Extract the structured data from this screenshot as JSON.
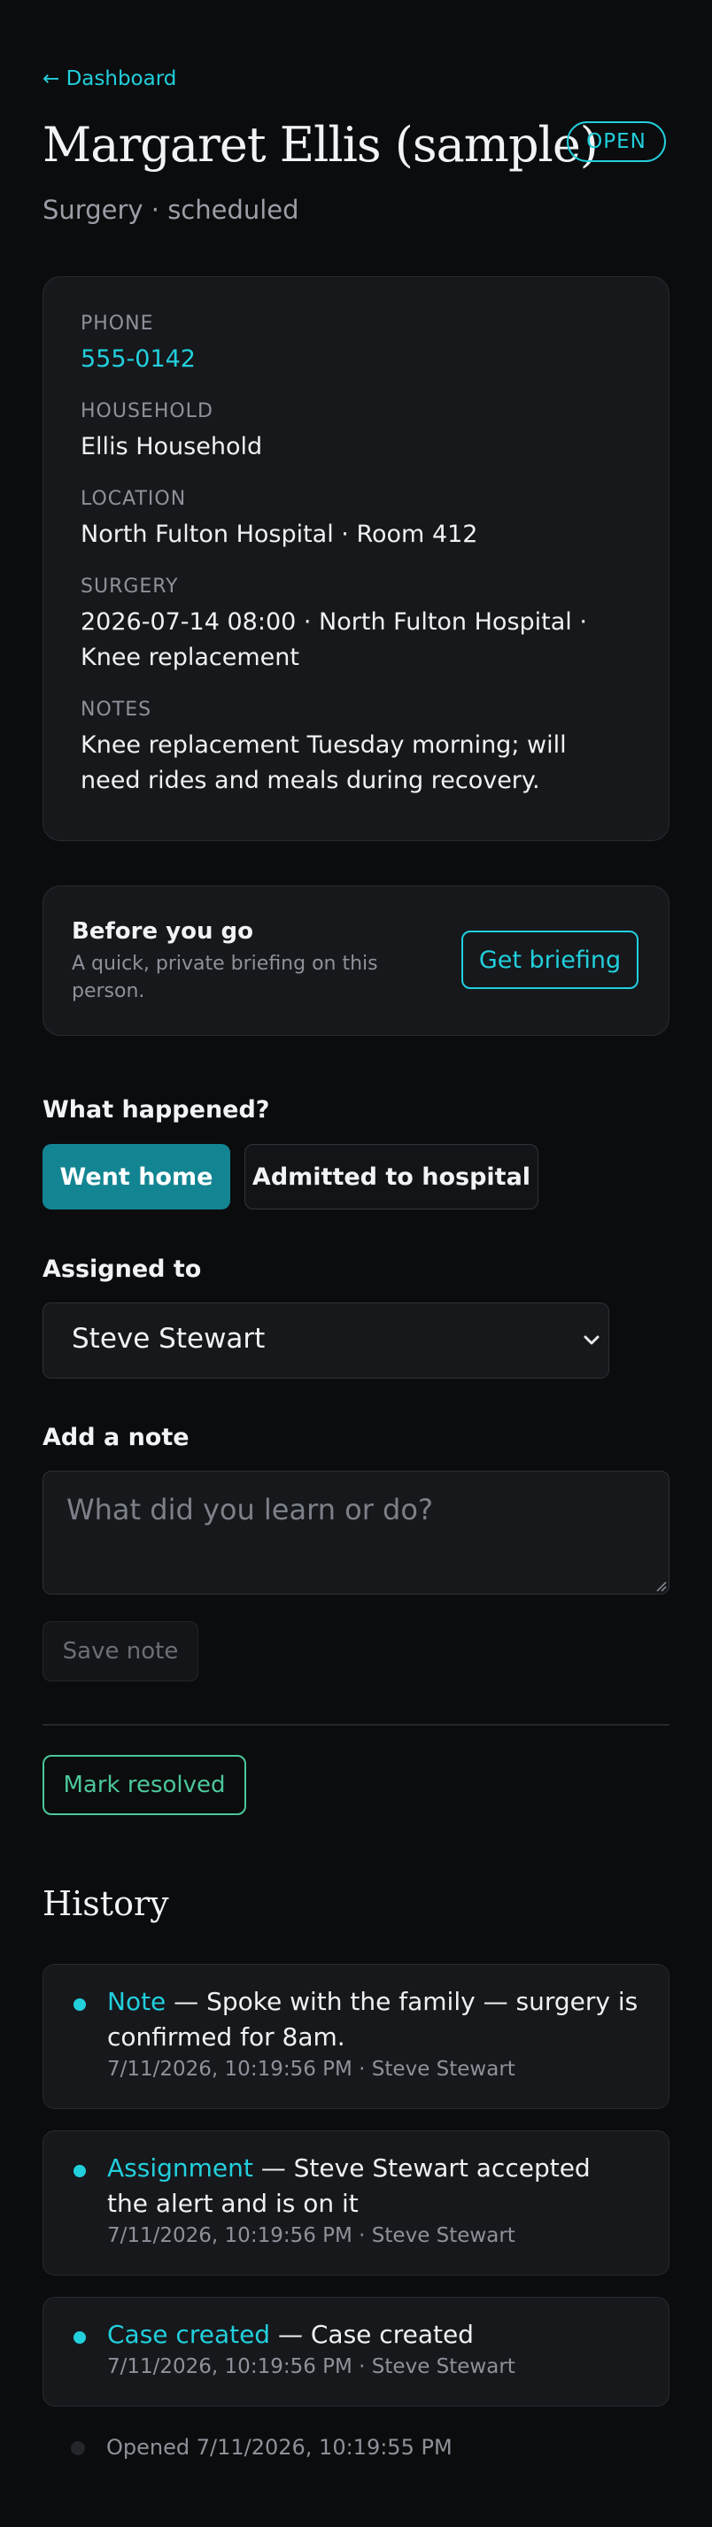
{
  "nav": {
    "back_label": "← Dashboard"
  },
  "header": {
    "title": "Margaret Ellis (sample)",
    "status": "OPEN",
    "subtitle": "Surgery · scheduled"
  },
  "details": [
    {
      "label": "PHONE",
      "value": "555-0142"
    },
    {
      "label": "HOUSEHOLD",
      "value": "Ellis Household"
    },
    {
      "label": "LOCATION",
      "value": "North Fulton Hospital · Room 412"
    },
    {
      "label": "SURGERY",
      "value": "2026-07-14 08:00 · North Fulton Hospital · Knee replacement"
    },
    {
      "label": "NOTES",
      "value": "Knee replacement Tuesday morning; will need rides and meals during recovery."
    }
  ],
  "briefing": {
    "title": "Before you go",
    "subtitle": "A quick, private briefing on this person.",
    "button": "Get briefing"
  },
  "outcome": {
    "label": "What happened?",
    "options": [
      "Went home",
      "Admitted to hospital"
    ],
    "selected": "Went home"
  },
  "assigned": {
    "label": "Assigned to",
    "value": "Steve Stewart"
  },
  "note": {
    "label": "Add a note",
    "placeholder": "What did you learn or do?",
    "save_label": "Save note"
  },
  "resolve_label": "Mark resolved",
  "history": {
    "title": "History",
    "items": [
      {
        "type": "Note",
        "text": " — Spoke with the family — surgery is confirmed for 8am.",
        "meta": "7/11/2026, 10:19:56 PM · Steve Stewart"
      },
      {
        "type": "Assignment",
        "text": " — Steve Stewart accepted the alert and is on it",
        "meta": "7/11/2026, 10:19:56 PM · Steve Stewart"
      },
      {
        "type": "Case created",
        "text": " — Case created",
        "meta": "7/11/2026, 10:19:56 PM · Steve Stewart"
      }
    ],
    "opened": "Opened 7/11/2026, 10:19:55 PM"
  },
  "colors": {
    "accent": "#22cfdc",
    "selected": "#138592",
    "resolve": "#4cc79a",
    "background": "#0b0c0e",
    "card": "#16181c"
  }
}
